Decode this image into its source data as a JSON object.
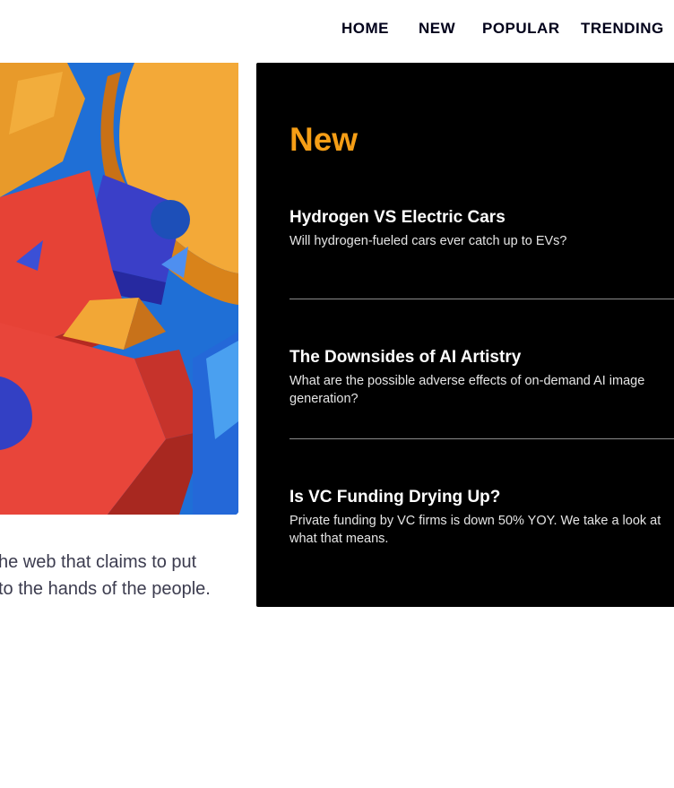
{
  "nav": {
    "items": [
      {
        "label": "HOME"
      },
      {
        "label": "NEW"
      },
      {
        "label": "POPULAR"
      },
      {
        "label": "TRENDING"
      }
    ]
  },
  "intro": {
    "line1": "he web that claims to put",
    "line2": "to the hands of the people."
  },
  "new_section": {
    "title": "New",
    "articles": [
      {
        "title": "Hydrogen VS Electric Cars",
        "summary": "Will hydrogen-fueled cars ever catch up to EVs?"
      },
      {
        "title": "The Downsides of AI Artistry",
        "summary": "What are the possible adverse effects of on-demand AI image generation?"
      },
      {
        "title": "Is VC Funding Drying Up?",
        "summary": "Private funding by VC firms is down 50% YOY. We take a look at what that means."
      }
    ]
  },
  "colors": {
    "accent": "#f59e16",
    "panel_background": "#000000",
    "text_dark": "#00001a"
  }
}
